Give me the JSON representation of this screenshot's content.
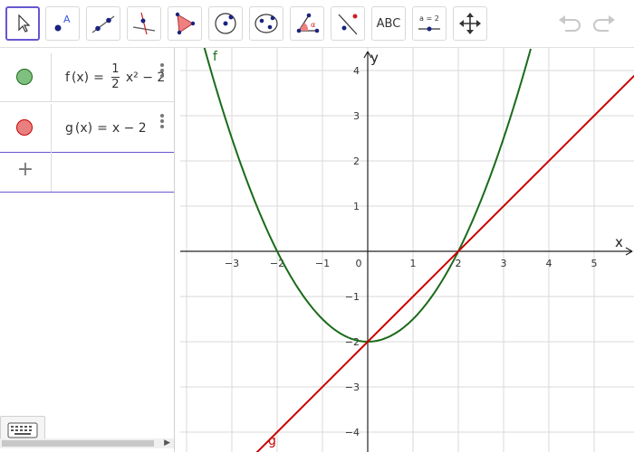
{
  "toolbar": {
    "tools": [
      {
        "name": "move-tool",
        "label": "move"
      },
      {
        "name": "point-tool",
        "label": "A"
      },
      {
        "name": "line-tool",
        "label": "line"
      },
      {
        "name": "perpendicular-line-tool",
        "label": "perpendicular"
      },
      {
        "name": "polygon-tool",
        "label": "polygon"
      },
      {
        "name": "circle-center-point-tool",
        "label": "circle"
      },
      {
        "name": "ellipse-tool",
        "label": "ellipse"
      },
      {
        "name": "angle-tool",
        "label": "α"
      },
      {
        "name": "reflect-tool",
        "label": "reflect"
      },
      {
        "name": "text-tool",
        "label": "ABC"
      },
      {
        "name": "slider-tool",
        "label": "a = 2"
      },
      {
        "name": "move-graphics-view-tool",
        "label": "move view"
      }
    ],
    "text_tool_label": "ABC",
    "slider_tool_label": "a = 2",
    "point_tool_label": "A",
    "angle_tool_label": "α"
  },
  "algebra": {
    "f": {
      "name": "f",
      "arg": "(x)",
      "eq": "=",
      "num": "1",
      "den": "2",
      "rest": "x² − 2",
      "color": "#1a6b1a",
      "marble": "#7fbf7f"
    },
    "g": {
      "name": "g",
      "arg": "(x)",
      "eq": "=",
      "rest": "x − 2",
      "color": "#cc0000",
      "marble": "#e88080"
    },
    "input_symbol": "+"
  },
  "graphics": {
    "x_axis_label": "x",
    "y_axis_label": "y",
    "x_ticks": [
      "−3",
      "−2",
      "−1",
      "0",
      "1",
      "2",
      "3",
      "4",
      "5"
    ],
    "y_ticks_pos": [
      "4",
      "3",
      "2",
      "1"
    ],
    "y_ticks_neg": [
      "−1",
      "−2",
      "−3",
      "−4"
    ],
    "f_label": "f",
    "g_label": "g",
    "f_color": "#1a6b1a",
    "g_color": "#cc0000",
    "grid_color": "#d8d8d8"
  }
}
